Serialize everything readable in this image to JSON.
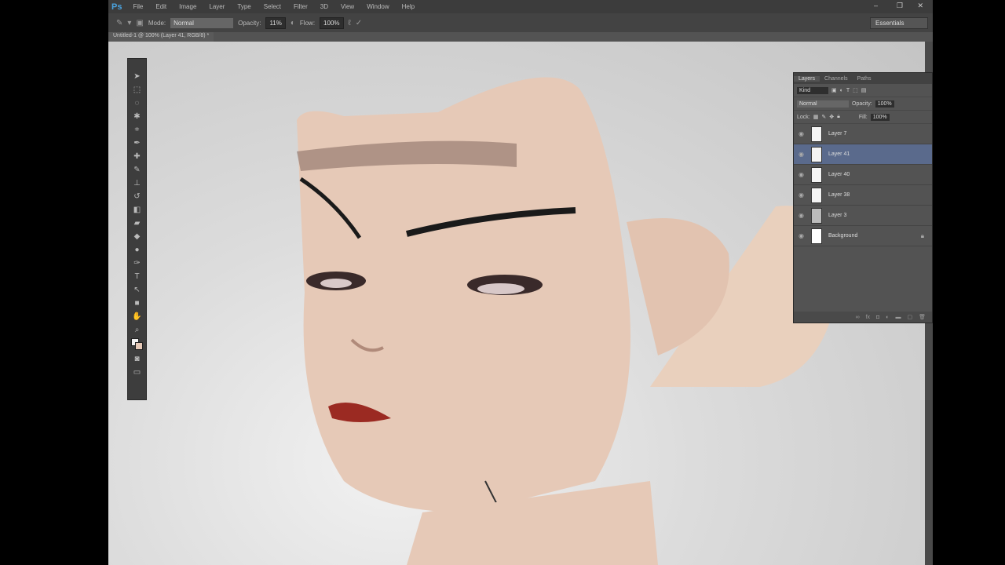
{
  "app": {
    "logo": "Ps",
    "menu": [
      "File",
      "Edit",
      "Image",
      "Layer",
      "Type",
      "Select",
      "Filter",
      "3D",
      "View",
      "Window",
      "Help"
    ],
    "window_controls": [
      "–",
      "❐",
      "✕"
    ]
  },
  "options": {
    "mode_label": "Mode:",
    "mode_value": "Normal",
    "opacity_label": "Opacity:",
    "opacity_value": "11%",
    "flow_label": "Flow:",
    "flow_value": "100%"
  },
  "workspace": "Essentials",
  "document_tab": "Untitled-1 @ 100% (Layer 41, RGB/8) *",
  "layers_panel": {
    "tabs": [
      "Layers",
      "Channels",
      "Paths"
    ],
    "filter": "Kind",
    "blend_mode": "Normal",
    "opacity_label": "Opacity:",
    "opacity_value": "100%",
    "lock_label": "Lock:",
    "fill_label": "Fill:",
    "fill_value": "100%",
    "layers": [
      {
        "name": "Layer 7",
        "selected": false
      },
      {
        "name": "Layer 41",
        "selected": true
      },
      {
        "name": "Layer 40",
        "selected": false
      },
      {
        "name": "Layer 38",
        "selected": false
      },
      {
        "name": "Layer 3",
        "selected": false
      },
      {
        "name": "Background",
        "selected": false
      }
    ]
  }
}
